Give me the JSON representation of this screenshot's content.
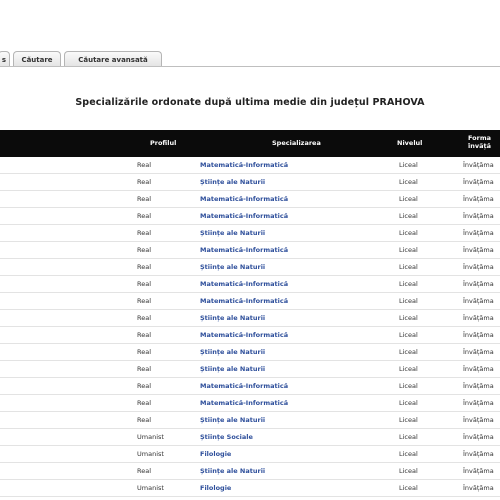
{
  "tabs": [
    {
      "label": "s"
    },
    {
      "label": "Căutare"
    },
    {
      "label": "Căutare avansată"
    }
  ],
  "title": "Specializările ordonate după ultima medie din județul PRAHOVA",
  "table": {
    "headers": {
      "profil": "Profilul",
      "specializare": "Specializarea",
      "nivel": "Nivelul",
      "forma": "Forma învăță"
    },
    "rows": [
      {
        "profil": "Real",
        "specializare": "Matematică-Informatică",
        "nivel": "Liceal",
        "forma": "Învățăma"
      },
      {
        "profil": "Real",
        "specializare": "Științe ale Naturii",
        "nivel": "Liceal",
        "forma": "Învățăma"
      },
      {
        "profil": "Real",
        "specializare": "Matematică-Informatică",
        "nivel": "Liceal",
        "forma": "Învățăma"
      },
      {
        "profil": "Real",
        "specializare": "Matematică-Informatică",
        "nivel": "Liceal",
        "forma": "Învățăma"
      },
      {
        "profil": "Real",
        "specializare": "Științe ale Naturii",
        "nivel": "Liceal",
        "forma": "Învățăma"
      },
      {
        "profil": "Real",
        "specializare": "Matematică-Informatică",
        "nivel": "Liceal",
        "forma": "Învățăma"
      },
      {
        "profil": "Real",
        "specializare": "Științe ale Naturii",
        "nivel": "Liceal",
        "forma": "Învățăma"
      },
      {
        "profil": "Real",
        "specializare": "Matematică-Informatică",
        "nivel": "Liceal",
        "forma": "Învățăma"
      },
      {
        "profil": "Real",
        "specializare": "Matematică-Informatică",
        "nivel": "Liceal",
        "forma": "Învățăma"
      },
      {
        "profil": "Real",
        "specializare": "Științe ale Naturii",
        "nivel": "Liceal",
        "forma": "Învățăma"
      },
      {
        "profil": "Real",
        "specializare": "Matematică-Informatică",
        "nivel": "Liceal",
        "forma": "Învățăma"
      },
      {
        "profil": "Real",
        "specializare": "Științe ale Naturii",
        "nivel": "Liceal",
        "forma": "Învățăma"
      },
      {
        "profil": "Real",
        "specializare": "Științe ale Naturii",
        "nivel": "Liceal",
        "forma": "Învățăma"
      },
      {
        "profil": "Real",
        "specializare": "Matematică-Informatică",
        "nivel": "Liceal",
        "forma": "Învățăma"
      },
      {
        "profil": "Real",
        "specializare": "Matematică-Informatică",
        "nivel": "Liceal",
        "forma": "Învățăma"
      },
      {
        "profil": "Real",
        "specializare": "Științe ale Naturii",
        "nivel": "Liceal",
        "forma": "Învățăma"
      },
      {
        "profil": "Umanist",
        "specializare": "Științe Sociale",
        "nivel": "Liceal",
        "forma": "Învățăma"
      },
      {
        "profil": "Umanist",
        "specializare": "Filologie",
        "nivel": "Liceal",
        "forma": "Învățăma"
      },
      {
        "profil": "Real",
        "specializare": "Științe ale Naturii",
        "nivel": "Liceal",
        "forma": "Învățăma"
      },
      {
        "profil": "Umanist",
        "specializare": "Filologie",
        "nivel": "Liceal",
        "forma": "Învățăma"
      }
    ]
  }
}
